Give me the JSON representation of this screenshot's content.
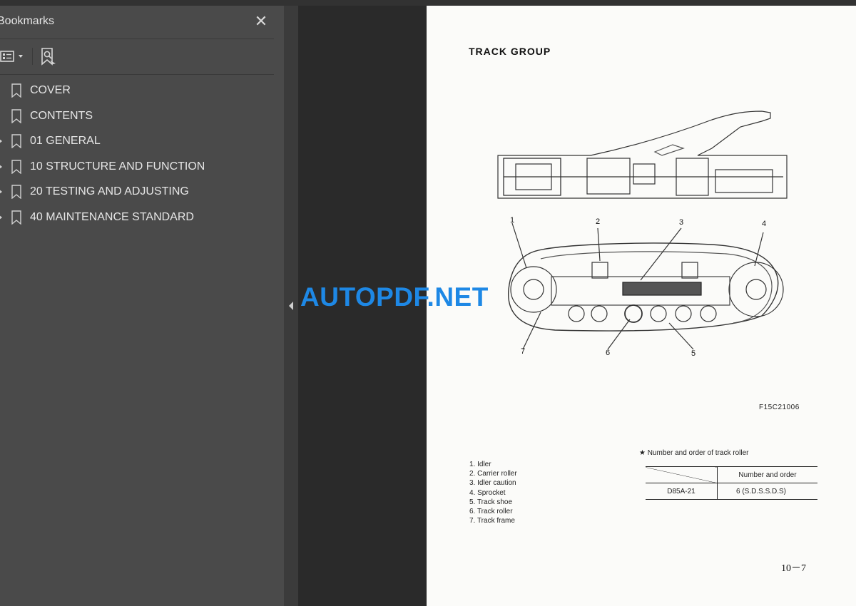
{
  "panel": {
    "title": "Bookmarks",
    "close_icon": "close-icon",
    "toolbar": {
      "options_icon": "bookmark-options-icon",
      "find_icon": "find-current-bookmark-icon"
    }
  },
  "bookmarks": [
    {
      "label": "COVER",
      "expandable": false
    },
    {
      "label": "CONTENTS",
      "expandable": false
    },
    {
      "label": "01 GENERAL",
      "expandable": true
    },
    {
      "label": "10 STRUCTURE AND FUNCTION",
      "expandable": true
    },
    {
      "label": "20 TESTING AND ADJUSTING",
      "expandable": true
    },
    {
      "label": "40 MAINTENANCE STANDARD",
      "expandable": true
    }
  ],
  "document": {
    "title": "TRACK GROUP",
    "figure_code": "F15C21006",
    "callouts": [
      "1",
      "2",
      "3",
      "4",
      "5",
      "6",
      "7"
    ],
    "legend": [
      "1. Idler",
      "2. Carrier roller",
      "3. Idler caution",
      "4. Sprocket",
      "5. Track shoe",
      "6. Track roller",
      "7. Track frame"
    ],
    "table_note": "★ Number and order of track roller",
    "table": {
      "header": [
        "",
        "Number and order"
      ],
      "rows": [
        [
          "D85A-21",
          "6 (S.D.S.S.D.S)"
        ]
      ]
    },
    "page_number": "10－7"
  },
  "watermark": "AUTOPDF.NET",
  "colors": {
    "panel_bg": "#4a4a4a",
    "viewer_bg": "#2a2a2a",
    "watermark": "#1e88e5"
  }
}
